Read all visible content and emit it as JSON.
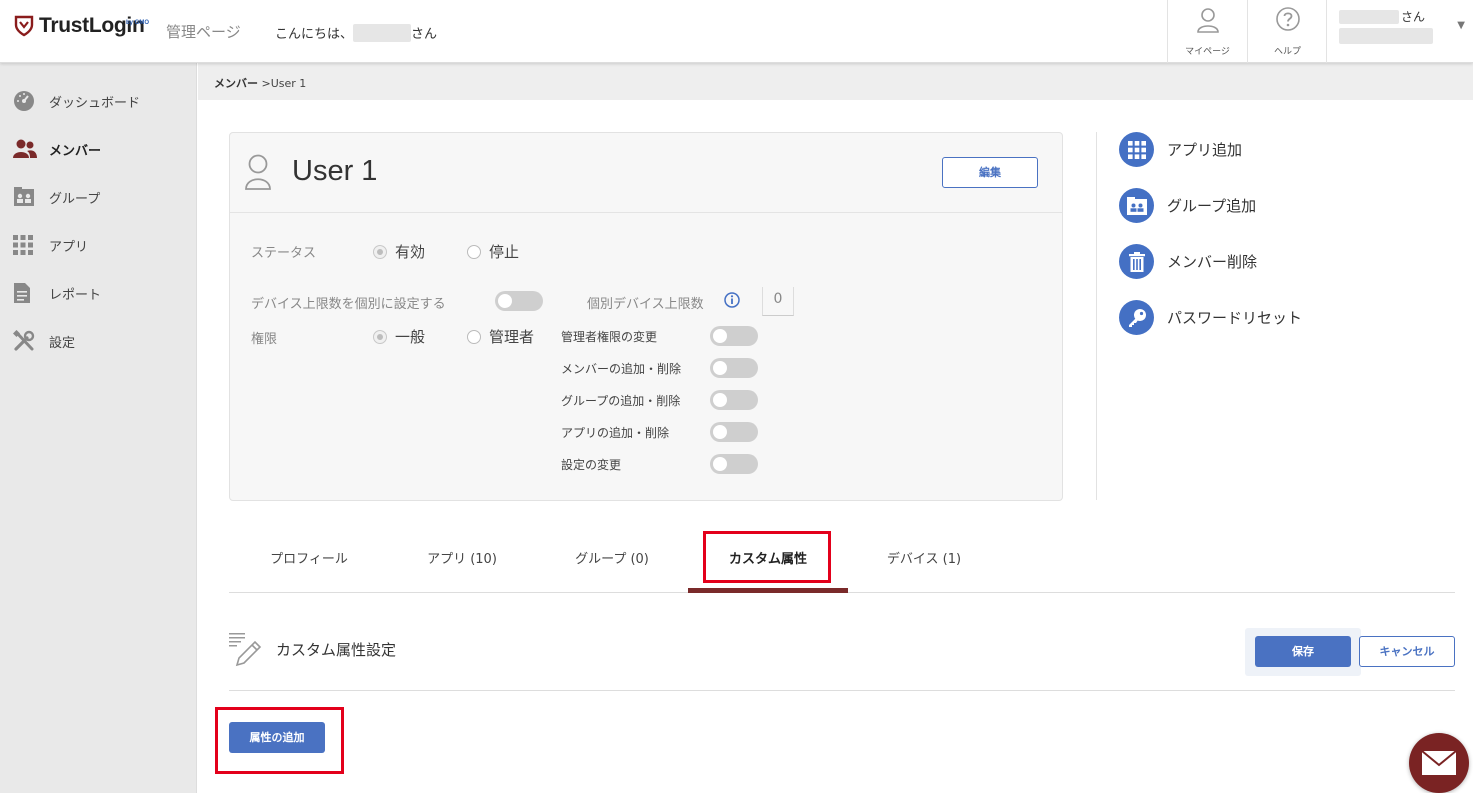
{
  "header": {
    "logo_text": "TrustLogin",
    "logo_sub": "by GMO",
    "admin_title": "管理ページ",
    "greeting_prefix": "こんにちは、",
    "greeting_suffix": "さん",
    "mypage_label": "マイページ",
    "help_label": "ヘルプ",
    "user_suffix": "さん",
    "caret": "▼"
  },
  "sidebar": {
    "items": [
      {
        "label": "ダッシュボード"
      },
      {
        "label": "メンバー"
      },
      {
        "label": "グループ"
      },
      {
        "label": "アプリ"
      },
      {
        "label": "レポート"
      },
      {
        "label": "設定"
      }
    ]
  },
  "breadcrumb": {
    "parent": "メンバー",
    "separator": " >",
    "current": "User 1"
  },
  "user_card": {
    "name": "User 1",
    "edit_label": "編集",
    "status_label": "ステータス",
    "status_options": [
      "有効",
      "停止"
    ],
    "device_limit_label": "デバイス上限数を個別に設定する",
    "individual_limit_label": "個別デバイス上限数",
    "individual_limit_value": "0",
    "role_label": "権限",
    "role_options": [
      "一般",
      "管理者"
    ],
    "permissions": [
      {
        "label": "管理者権限の変更"
      },
      {
        "label": "メンバーの追加・削除"
      },
      {
        "label": "グループの追加・削除"
      },
      {
        "label": "アプリの追加・削除"
      },
      {
        "label": "設定の変更"
      }
    ]
  },
  "actions": [
    {
      "label": "アプリ追加"
    },
    {
      "label": "グループ追加"
    },
    {
      "label": "メンバー削除"
    },
    {
      "label": "パスワードリセット"
    }
  ],
  "tabs": [
    {
      "label": "プロフィール"
    },
    {
      "label": "アプリ (10)"
    },
    {
      "label": "グループ (0)"
    },
    {
      "label": "カスタム属性"
    },
    {
      "label": "デバイス (1)"
    }
  ],
  "section": {
    "title": "カスタム属性設定",
    "save_label": "保存",
    "cancel_label": "キャンセル",
    "add_attr_label": "属性の追加"
  },
  "colors": {
    "accent": "#4a72c2",
    "brand": "#7a2a2a",
    "highlight": "#e3001b"
  }
}
